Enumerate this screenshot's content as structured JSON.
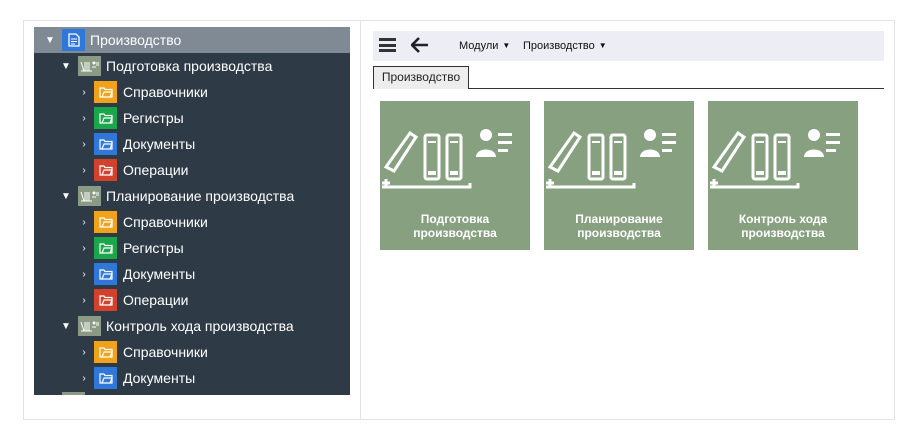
{
  "tree": {
    "items": [
      {
        "level": 0,
        "icon": "document-icon",
        "label": "Производство"
      },
      {
        "level": 1,
        "icon": "module-icon",
        "label": "Подготовка производства"
      },
      {
        "level": 2,
        "icon": "folder-orange-icon",
        "label": "Справочники"
      },
      {
        "level": 2,
        "icon": "folder-green-icon",
        "label": "Регистры"
      },
      {
        "level": 2,
        "icon": "folder-blue-icon",
        "label": "Документы"
      },
      {
        "level": 2,
        "icon": "folder-red-icon",
        "label": "Операции"
      },
      {
        "level": 1,
        "icon": "module-icon",
        "label": "Планирование производства"
      },
      {
        "level": 2,
        "icon": "folder-orange-icon",
        "label": "Справочники"
      },
      {
        "level": 2,
        "icon": "folder-green-icon",
        "label": "Регистры"
      },
      {
        "level": 2,
        "icon": "folder-blue-icon",
        "label": "Документы"
      },
      {
        "level": 2,
        "icon": "folder-red-icon",
        "label": "Операции"
      },
      {
        "level": 1,
        "icon": "module-icon",
        "label": "Контроль хода производства"
      },
      {
        "level": 2,
        "icon": "folder-orange-icon",
        "label": "Справочники"
      },
      {
        "level": 2,
        "icon": "folder-blue-icon",
        "label": "Документы"
      }
    ]
  },
  "toolbar": {
    "menu_icon": "hamburger-icon",
    "back_icon": "arrow-left-icon",
    "modules_label": "Модули",
    "production_label": "Производство"
  },
  "tabs": [
    {
      "label": "Производство",
      "active": true
    }
  ],
  "tiles": [
    {
      "line1": "Подготовка",
      "line2": "производства",
      "icon": "binders-user-icon"
    },
    {
      "line1": "Планирование",
      "line2": "производства",
      "icon": "binders-user-icon"
    },
    {
      "line1": "Контроль хода",
      "line2": "производства",
      "icon": "binders-user-icon"
    }
  ],
  "colors": {
    "tree_bg": "#2e3a46",
    "tree_selected_bg": "#7f8a94",
    "tile_bg": "#87a080",
    "toolbar_bg": "#ededf5",
    "folder_orange": "#f0a21b",
    "folder_green": "#1aa64a",
    "folder_blue": "#2f77d8",
    "folder_red": "#d2412b"
  }
}
